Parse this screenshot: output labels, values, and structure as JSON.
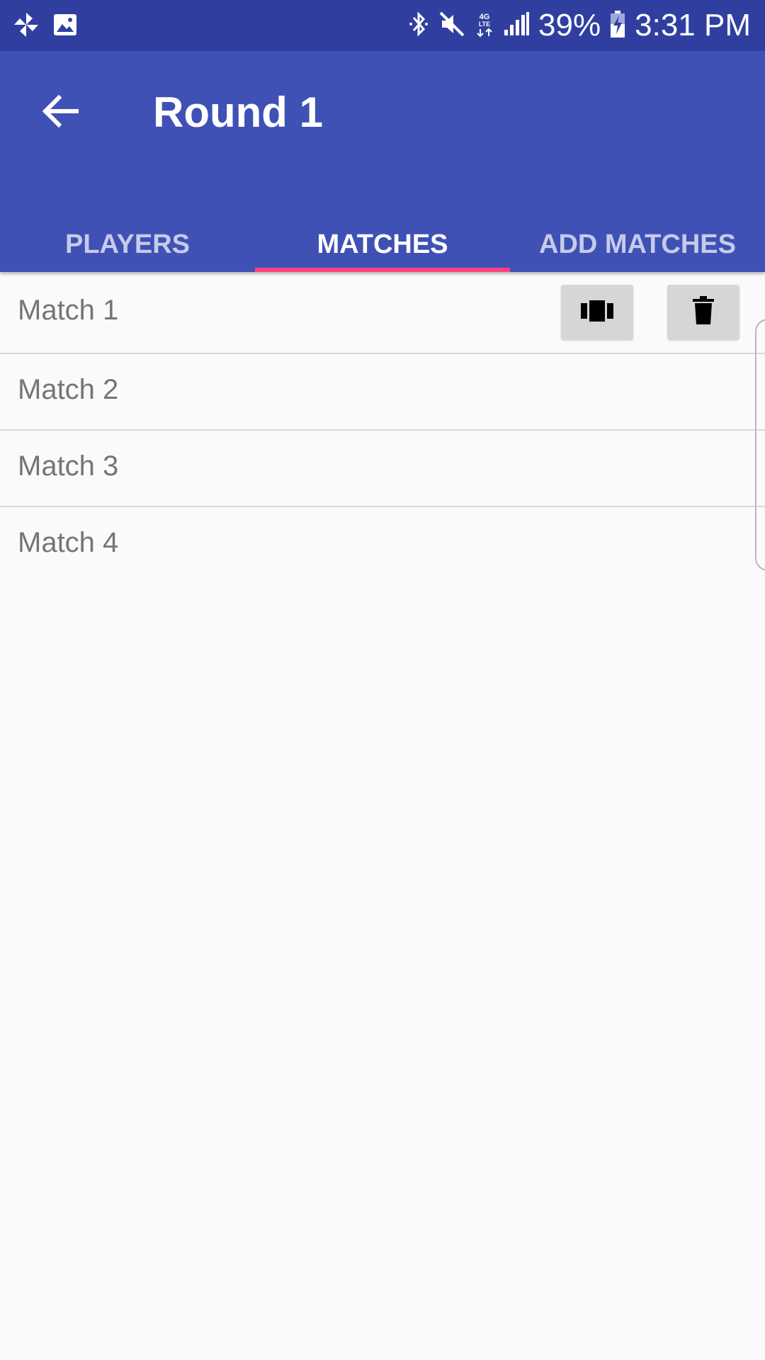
{
  "status_bar": {
    "left_icons": [
      "pinwheel-icon",
      "image-icon"
    ],
    "right_icons": [
      "bluetooth-icon",
      "mute-icon",
      "lte-icon",
      "signal-icon",
      "battery-charging-icon"
    ],
    "network_label": "4G LTE",
    "battery": "39%",
    "time": "3:31 PM",
    "background": "#303f9f"
  },
  "app_bar": {
    "title": "Round 1",
    "back_icon": "arrow-back-icon",
    "background": "#3f51b5"
  },
  "tabs": [
    {
      "label": "PLAYERS",
      "active": false
    },
    {
      "label": "MATCHES",
      "active": true
    },
    {
      "label": "ADD MATCHES",
      "active": false
    }
  ],
  "tab_indicator_color": "#ff4081",
  "matches": [
    {
      "label": "Match 1",
      "actions": [
        "view-carousel-icon",
        "trash-icon"
      ]
    },
    {
      "label": "Match 2"
    },
    {
      "label": "Match 3"
    },
    {
      "label": "Match 4"
    }
  ]
}
